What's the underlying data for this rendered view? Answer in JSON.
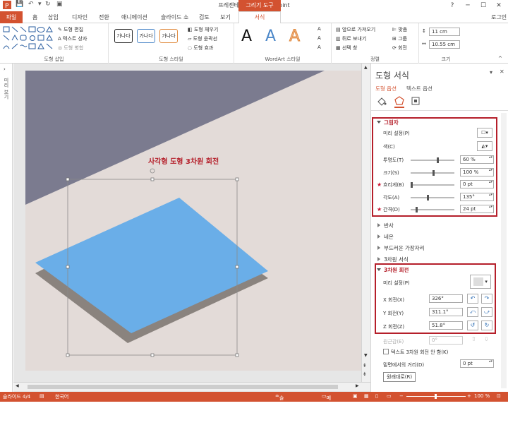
{
  "window": {
    "title": "프레젠테이션2 - PowerPoint",
    "context_tab": "그리기 도구",
    "signin": "로그인"
  },
  "tabs": [
    {
      "label": "파일"
    },
    {
      "label": "홈"
    },
    {
      "label": "삽입"
    },
    {
      "label": "디자인"
    },
    {
      "label": "전환"
    },
    {
      "label": "애니메이션"
    },
    {
      "label": "슬라이드 쇼"
    },
    {
      "label": "검토"
    },
    {
      "label": "보기"
    },
    {
      "label": "서식"
    }
  ],
  "ribbon": {
    "insert_shapes": {
      "label": "도형 삽입",
      "edit_shape": "도형 편집",
      "text_box": "텍스트 상자",
      "merge_shapes": "도형 병합"
    },
    "shape_styles": {
      "label": "도형 스타일",
      "preset": "가나다",
      "fill": "도형 채우기",
      "outline": "도형 윤곽선",
      "effects": "도형 효과"
    },
    "wordart": {
      "label": "WordArt 스타일",
      "sample": "A"
    },
    "arrange": {
      "label": "정렬",
      "bring_forward": "앞으로 가져오기",
      "send_backward": "뒤로 보내기",
      "selection_pane": "선택 창",
      "align": "맞춤",
      "group": "그룹",
      "rotate": "회전"
    },
    "size": {
      "label": "크기",
      "height": "11 cm",
      "width": "10.55 cm"
    }
  },
  "thumbnails_label": "미리 보기",
  "slide": {
    "title": "사각형 도형 3차원 회전",
    "title_color": "#b51f2a"
  },
  "panel": {
    "title": "도형 서식",
    "tab_shape": "도형 옵션",
    "tab_text": "텍스트 옵션",
    "shadow": {
      "header": "그림자",
      "preset_label": "미리 설정(P)",
      "color_label": "색(C)",
      "transparency_label": "투명도(T)",
      "transparency": "60 %",
      "transparency_frac": 0.6,
      "size_label": "크기(S)",
      "size": "100 %",
      "size_frac": 0.5,
      "blur_label": "흐리게(B)",
      "blur": "0 pt",
      "blur_frac": 0.0,
      "angle_label": "각도(A)",
      "angle": "135°",
      "angle_frac": 0.375,
      "distance_label": "간격(D)",
      "distance": "24 pt",
      "distance_frac": 0.12
    },
    "sections": [
      "반사",
      "네온",
      "부드러운 가장자리",
      "3차원 서식"
    ],
    "rotation": {
      "header": "3차원 회전",
      "preset_label": "미리 설정(P)",
      "x_label": "X 회전(X)",
      "x": "326°",
      "y_label": "Y 회전(Y)",
      "y": "311.1°",
      "z_label": "Z 회전(Z)",
      "z": "51.8°",
      "perspective_label": "원근감(E)",
      "perspective": "0°",
      "keep_text_flat": "텍스트 3차원 회전 안 함(K)",
      "distance_label": "밑면에서의 거리(D)",
      "distance": "0 pt",
      "reset": "원래대로(R)"
    }
  },
  "status": {
    "slide": "슬라이드 4/4",
    "language": "한국어",
    "notes": "슬라이드 노트",
    "comments": "메모",
    "zoom": "100 %"
  },
  "colors": {
    "accent": "#d35230",
    "shape_fill": "#6aaee8",
    "shadow": "#8a837e",
    "dark_band": "#7b7b8f",
    "slide_bg": "#e3dbd8",
    "highlight": "#b51f2a"
  }
}
